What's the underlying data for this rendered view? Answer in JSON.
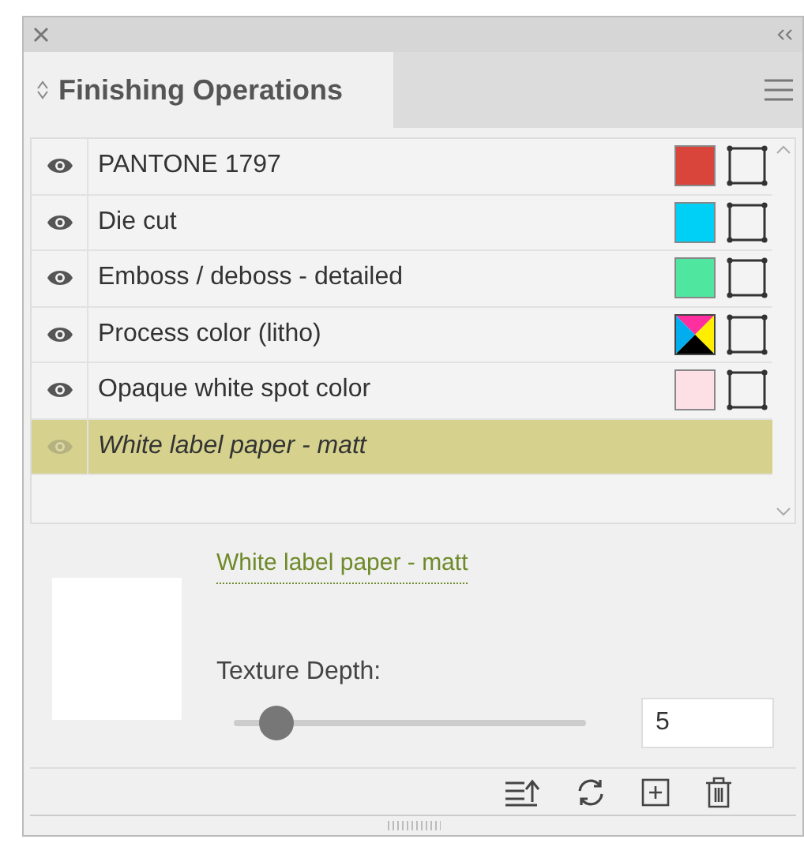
{
  "panel": {
    "title": "Finishing Operations"
  },
  "operations": [
    {
      "name": "PANTONE 1797",
      "kind": "spot",
      "color": "#d9443b",
      "visible": true,
      "selected": false
    },
    {
      "name": "Die cut",
      "kind": "spot",
      "color": "#00d0f5",
      "visible": true,
      "selected": false
    },
    {
      "name": "Emboss / deboss - detailed",
      "kind": "spot",
      "color": "#4fe6a0",
      "visible": true,
      "selected": false
    },
    {
      "name": "Process color (litho)",
      "kind": "process",
      "visible": true,
      "selected": false
    },
    {
      "name": "Opaque white spot color",
      "kind": "spot",
      "color": "#fde0e6",
      "visible": true,
      "selected": false
    },
    {
      "name": "White label paper - matt",
      "kind": "substrate",
      "visible": false,
      "selected": true
    }
  ],
  "detail": {
    "name": "White label paper - matt",
    "slider_label": "Texture Depth:",
    "level": 0.12,
    "value": "5"
  }
}
